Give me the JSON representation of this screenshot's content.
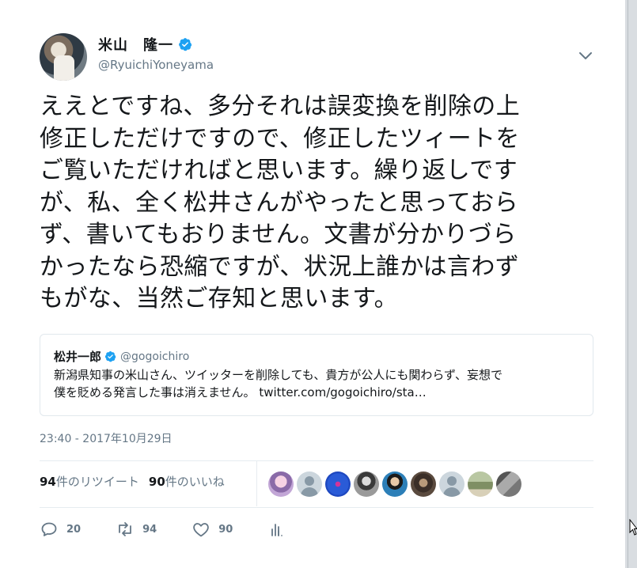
{
  "tweet": {
    "author": {
      "display_name": "米山　隆一",
      "handle": "@RyuichiYoneyama",
      "verified": true
    },
    "text_lines": [
      "ええとですね、多分それは誤変換を削除の上",
      "修正しただけですので、修正したツィートを",
      "ご覧いただければと思います。繰り返しです",
      "が、私、全く松井さんがやったと思っておら",
      "ず、書いてもおりません。文書が分かりづら",
      "かったなら恐縮ですが、状況上誰かは言わず",
      "もがな、当然ご存知と思います。"
    ],
    "quoted": {
      "display_name": "松井一郎",
      "handle": "@gogoichiro",
      "text_lines": [
        "新潟県知事の米山さん、ツイッターを削除しても、貴方が公人にも関わらず、妄想で",
        "僕を貶める発言した事は消えません。 twitter.com/gogoichiro/sta…"
      ]
    },
    "timestamp": "23:40 - 2017年10月29日",
    "stats": {
      "retweets_count": "94",
      "retweets_label": "件のリツイート",
      "likes_count": "90",
      "likes_label": "件のいいね"
    },
    "liker_avatars": [
      "avatar-anime",
      "avatar-default",
      "avatar-blue",
      "avatar-bw-portrait",
      "avatar-person",
      "avatar-dark",
      "avatar-default",
      "avatar-landscape",
      "avatar-gray"
    ],
    "actions": {
      "reply_count": "20",
      "retweet_count": "94",
      "like_count": "90"
    }
  },
  "colors": {
    "text": "#14171a",
    "secondary": "#657786",
    "verified": "#1da1f2",
    "border": "#e1e8ed"
  }
}
